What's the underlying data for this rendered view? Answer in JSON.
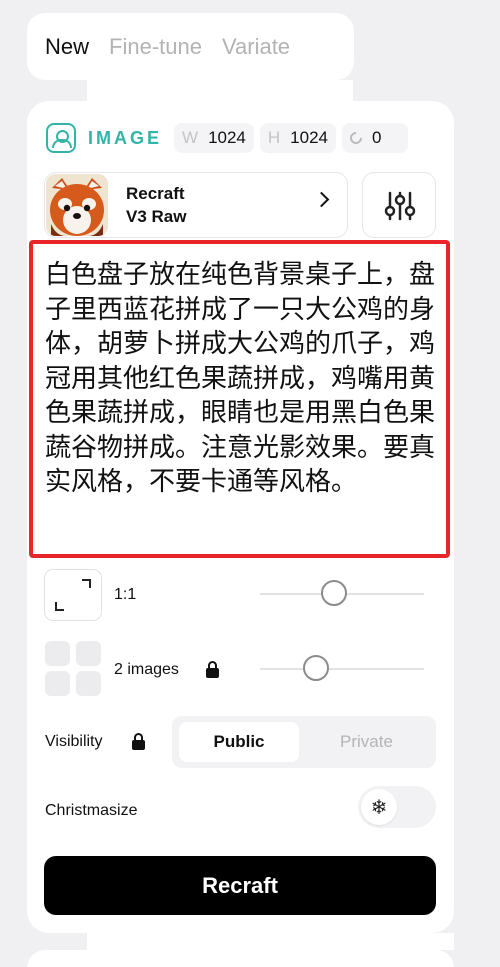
{
  "tabs": [
    {
      "label": "New",
      "active": true
    },
    {
      "label": "Fine-tune",
      "active": false
    },
    {
      "label": "Variate",
      "active": false
    }
  ],
  "image_settings": {
    "label": "IMAGE",
    "width_letter": "W",
    "width": "1024",
    "height_letter": "H",
    "height": "1024",
    "seed": "0"
  },
  "model": {
    "name_line1": "Recraft",
    "name_line2": "V3 Raw"
  },
  "prompt": {
    "text": "白色盘子放在纯色背景桌子上，盘子里西蓝花拼成了一只大公鸡的身体，胡萝卜拼成大公鸡的爪子，鸡冠用其他红色果蔬拼成，鸡嘴用黄色果蔬拼成，眼睛也是用黑白色果蔬谷物拼成。注意光影效果。要真实风格，不要卡通等风格。"
  },
  "aspect_ratio": {
    "label": "1:1"
  },
  "image_count": {
    "label": "2 images"
  },
  "visibility": {
    "label": "Visibility",
    "options": [
      "Public",
      "Private"
    ],
    "selected": "Public"
  },
  "christmasize": {
    "label": "Christmasize",
    "icon": "❄"
  },
  "generate_button": {
    "label": "Recraft"
  },
  "colors": {
    "accent": "#34b3a8",
    "highlight_border": "#e8262a",
    "primary_button": "#000000"
  }
}
